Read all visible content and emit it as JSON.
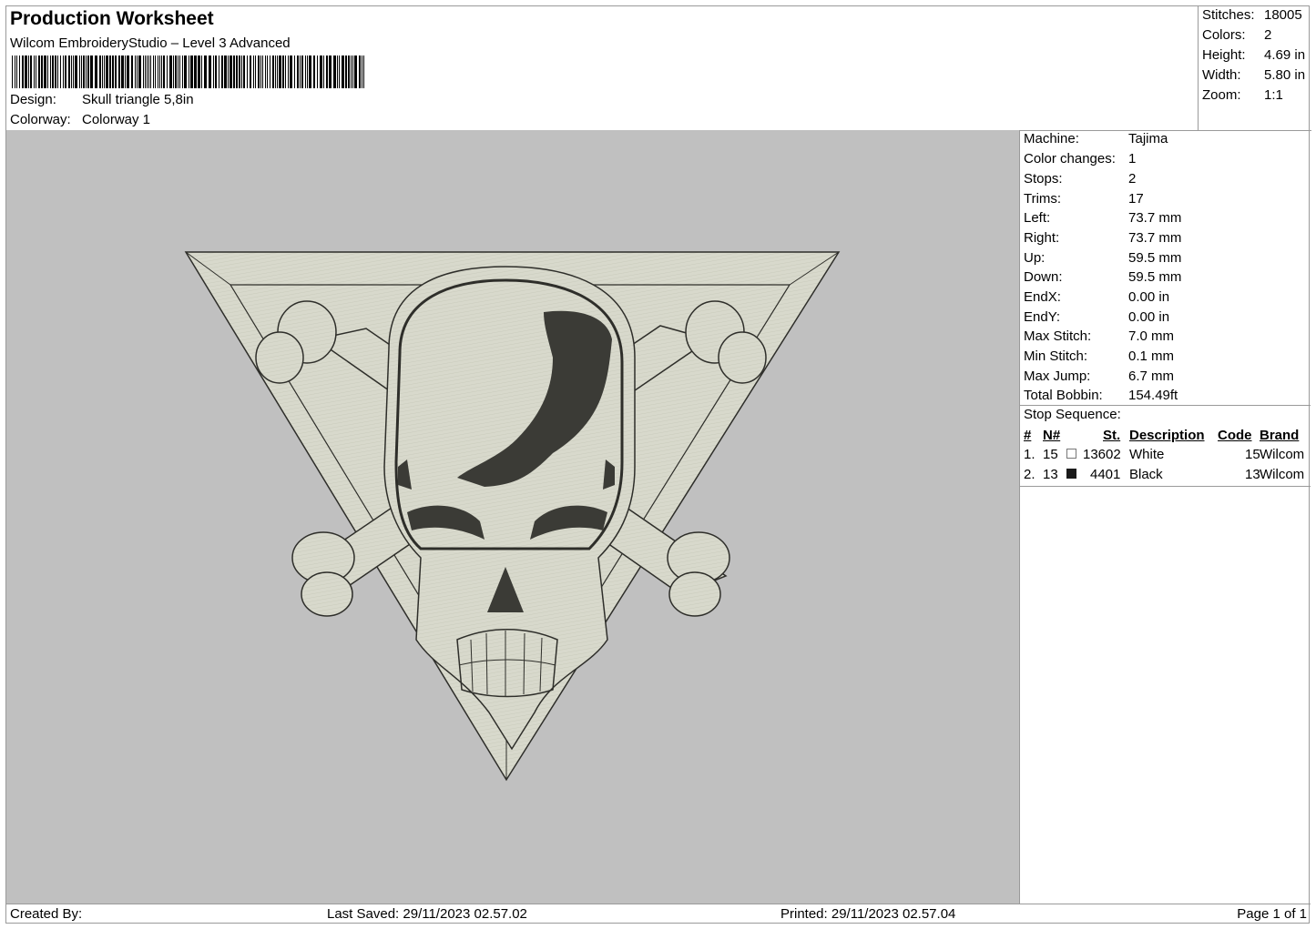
{
  "header": {
    "title": "Production Worksheet",
    "subtitle": "Wilcom EmbroideryStudio – Level 3 Advanced",
    "design_label": "Design:",
    "design_value": "Skull  triangle 5,8in",
    "colorway_label": "Colorway:",
    "colorway_value": "Colorway 1"
  },
  "summary": [
    {
      "label": "Stitches:",
      "value": "18005"
    },
    {
      "label": "Colors:",
      "value": "2"
    },
    {
      "label": "Height:",
      "value": "4.69 in"
    },
    {
      "label": "Width:",
      "value": "5.80 in"
    },
    {
      "label": "Zoom:",
      "value": "1:1"
    }
  ],
  "machine": [
    {
      "label": "Machine:",
      "value": "Tajima"
    },
    {
      "label": "Color changes:",
      "value": "1"
    },
    {
      "label": "Stops:",
      "value": "2"
    },
    {
      "label": "Trims:",
      "value": "17"
    },
    {
      "label": "Left:",
      "value": "73.7 mm"
    },
    {
      "label": "Right:",
      "value": "73.7 mm"
    },
    {
      "label": "Up:",
      "value": "59.5 mm"
    },
    {
      "label": "Down:",
      "value": "59.5 mm"
    },
    {
      "label": "EndX:",
      "value": "0.00 in"
    },
    {
      "label": "EndY:",
      "value": "0.00 in"
    },
    {
      "label": "Max Stitch:",
      "value": "7.0 mm"
    },
    {
      "label": "Min Stitch:",
      "value": "0.1 mm"
    },
    {
      "label": "Max Jump:",
      "value": "6.7 mm"
    },
    {
      "label": "Total Bobbin:",
      "value": "154.49ft"
    }
  ],
  "stop_sequence": {
    "label": "Stop Sequence:",
    "columns": [
      "#",
      "N#",
      "St.",
      "Description",
      "Code",
      "Brand"
    ],
    "rows": [
      {
        "index": "1.",
        "needle": "15",
        "stitches": "13602",
        "description": "White",
        "code": "15",
        "brand": "Wilcom",
        "swatch_color": "#ffffff"
      },
      {
        "index": "2.",
        "needle": "13",
        "stitches": "4401",
        "description": "Black",
        "code": "13",
        "brand": "Wilcom",
        "swatch_color": "#1a1a1a"
      }
    ]
  },
  "colors": {
    "canvas_background": "#c0c0c0",
    "thread_white": "#d8d9cc",
    "thread_black": "#3b3b36"
  },
  "footer": {
    "created_by": "Created By:",
    "last_saved": "Last Saved: 29/11/2023 02.57.02",
    "printed": "Printed: 29/11/2023 02.57.04",
    "page": "Page 1 of 1"
  }
}
